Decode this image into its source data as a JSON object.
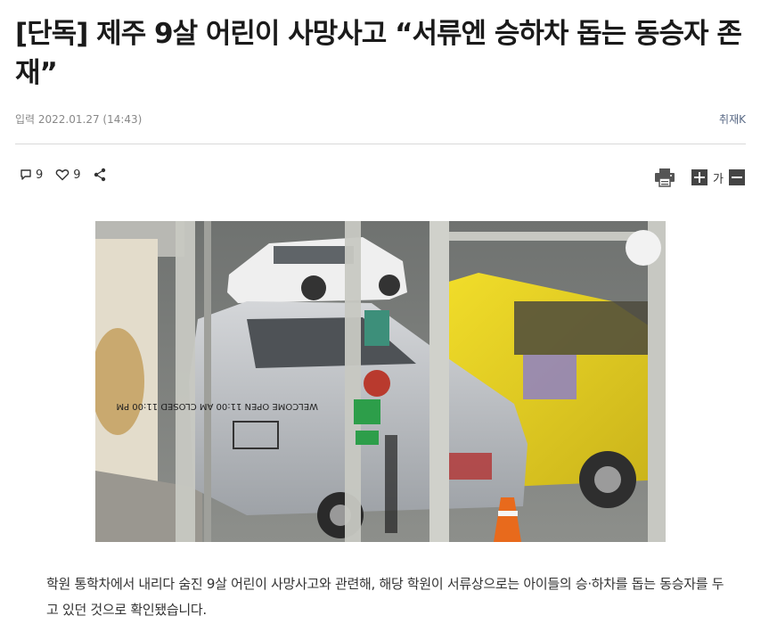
{
  "article": {
    "title": "[단독] 제주 9살 어린이 사망사고 “서류엔 승하차 돕는 동승자 존재”",
    "date": "입력 2022.01.27 (14:43)",
    "reporter": "취재K",
    "body": "학원 통학차에서 내리다 숨진 9살 어린이 사망사고와 관련해, 해당 학원이 서류상으로는 아이들의 승·하차를 돕는 동승자를 두고 있던 것으로 확인됐습니다."
  },
  "actions": {
    "comment_count": "9",
    "like_count": "9"
  },
  "tools": {
    "font_label": "가"
  },
  "photo": {
    "door_sign": "WELCOME OPEN 11:00 AM CLOSED 11:00 PM"
  },
  "colors": {
    "taxi_yellow": "#e8d21c",
    "car_white": "#eeeeee",
    "car_silver": "#b9bcc0"
  }
}
